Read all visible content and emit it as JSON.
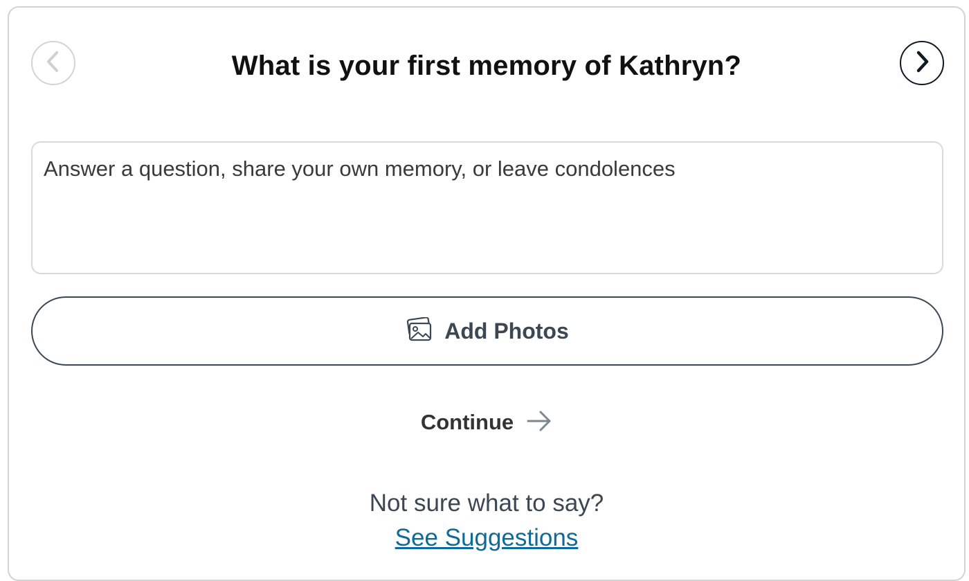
{
  "prompt": {
    "title": "What is your first memory of Kathryn?"
  },
  "nav": {
    "prev_icon": "chevron-left-icon",
    "next_icon": "chevron-right-icon"
  },
  "memory_input": {
    "value": "",
    "placeholder": "Answer a question, share your own memory, or leave condolences"
  },
  "add_photos": {
    "label": "Add Photos",
    "icon": "photos-icon"
  },
  "continue": {
    "label": "Continue",
    "icon": "arrow-right-icon"
  },
  "help": {
    "text": "Not sure what to say?",
    "link_label": "See Suggestions"
  },
  "colors": {
    "card_border": "#d3d3d3",
    "disabled_nav": "#d4d4d4",
    "active_nav": "#0f1a24",
    "button_text": "#3b4752",
    "link": "#0d6a99"
  }
}
